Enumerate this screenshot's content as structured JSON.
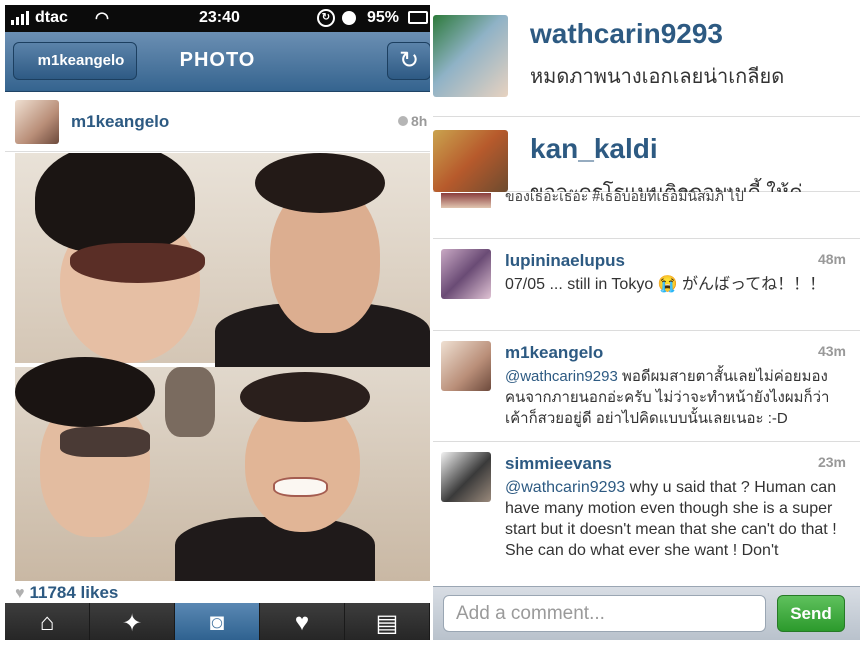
{
  "status": {
    "carrier": "dtac",
    "time": "23:40",
    "battery": "95%"
  },
  "nav": {
    "back_label": "m1keangelo",
    "title": "PHOTO"
  },
  "post": {
    "username": "m1keangelo",
    "time_ago": "8h",
    "likes": "11784 likes"
  },
  "tabs": [
    {
      "name": "home",
      "icon": "house-icon"
    },
    {
      "name": "explore",
      "icon": "star-icon"
    },
    {
      "name": "camera",
      "icon": "camera-icon",
      "active": true
    },
    {
      "name": "news",
      "icon": "heart-bubble-icon"
    },
    {
      "name": "profile",
      "icon": "profile-card-icon"
    }
  ],
  "comments_top": [
    {
      "user": "wathcarin9293",
      "text": "หมดภาพนางเอกเลยน่าเกลียด"
    },
    {
      "user": "kan_kaldi",
      "text": "ขอละครโรแมนติกคอมเมดี้ ให้คู่"
    }
  ],
  "comment_cut": {
    "text": "ของเธอะเธอะ #เธอบอยที่เธอมีนิสมภิ ไป"
  },
  "comments": [
    {
      "user": "lupininaelupus",
      "time": "48m",
      "text": "07/05 ... still in Tokyo 😭 がんばってね！！！"
    },
    {
      "user": "m1keangelo",
      "time": "43m",
      "mention": "@wathcarin9293",
      "text": " พอดีผมสายตาสั้นเลยไม่ค่อยมองคนจากภายนอกอ่ะครับ ไม่ว่าจะทำหน้ายังไงผมก็ว่าเค้าก็สวยอยู่ดี อย่าไปคิดแบบนั้นเลยเนอะ :-D"
    },
    {
      "user": "simmieevans",
      "time": "23m",
      "mention": "@wathcarin9293",
      "text": " why u said that ? Human can have many motion even though  she  is a super start but it doesn't mean that she can't do that ! She can do what ever she want ! Don't"
    }
  ],
  "comment_bar": {
    "placeholder": "Add a comment...",
    "send_label": "Send"
  },
  "colors": {
    "username_blue": "#2d5a82",
    "nav_blue": "#35648f",
    "send_green": "#2c9a2c"
  }
}
